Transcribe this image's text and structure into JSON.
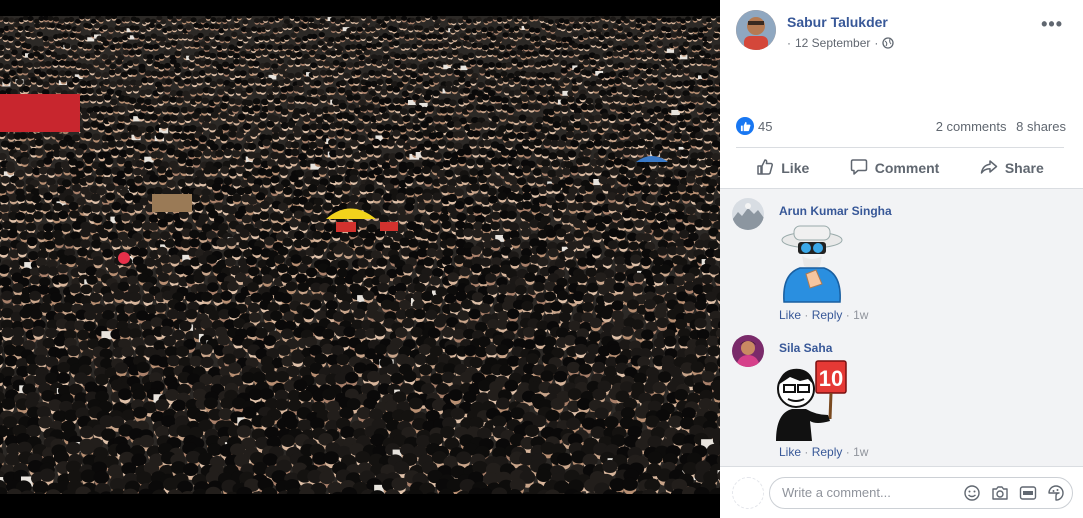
{
  "post": {
    "author": "Sabur Talukder",
    "date": "12 September",
    "separator": "·",
    "more": "•••",
    "likes": "45",
    "comments_count": "2 comments",
    "shares_count": "8 shares"
  },
  "actions": {
    "like": "Like",
    "comment": "Comment",
    "share": "Share"
  },
  "comments": [
    {
      "name": "Arun Kumar Singha",
      "like": "Like",
      "reply": "Reply",
      "sep": "·",
      "time": "1w"
    },
    {
      "name": "Sila Saha",
      "like": "Like",
      "reply": "Reply",
      "sep": "·",
      "time": "1w"
    }
  ],
  "sticker_10_label": "10",
  "write_comment": {
    "placeholder": "Write a comment..."
  },
  "colors": {
    "link": "#385898",
    "like_blue": "#1877f2",
    "muted": "#606770"
  }
}
